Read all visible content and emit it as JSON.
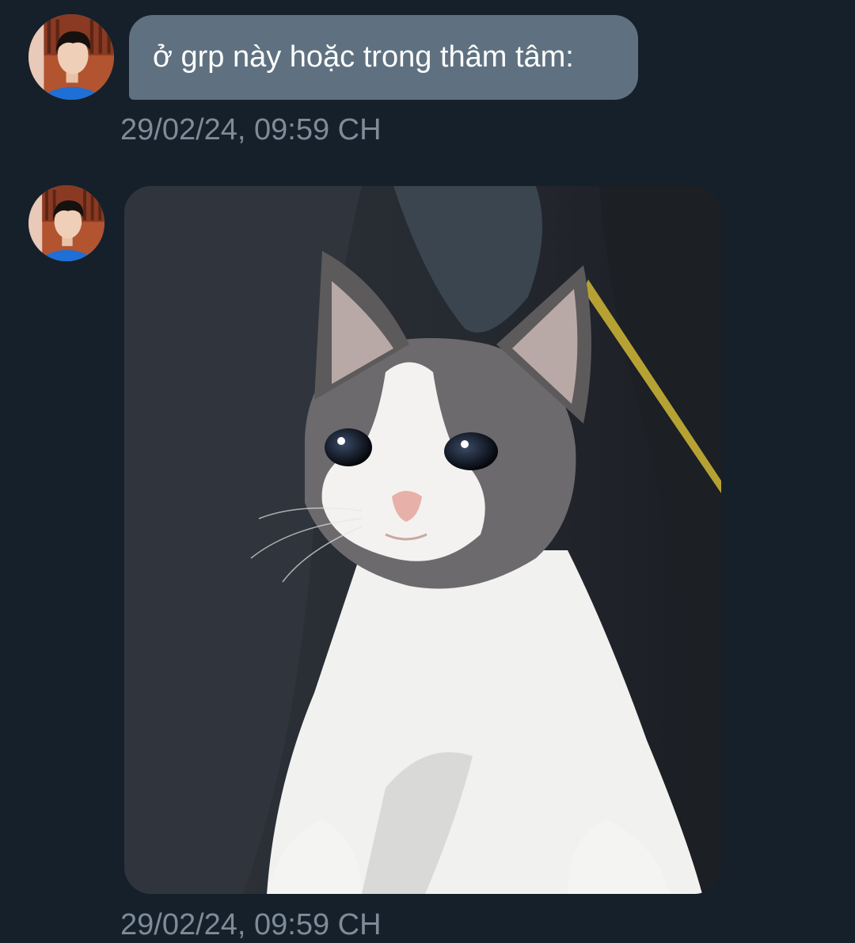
{
  "messages": [
    {
      "type": "text",
      "text": "ở grp này hoặc trong thâm tâm:",
      "timestamp": "29/02/24, 09:59 CH"
    },
    {
      "type": "image",
      "image": "crying-cat-photo",
      "timestamp": "29/02/24, 09:59 CH"
    }
  ],
  "colors": {
    "background": "#16202a",
    "bubble": "#5f7180",
    "timestamp": "#7e8b98"
  }
}
